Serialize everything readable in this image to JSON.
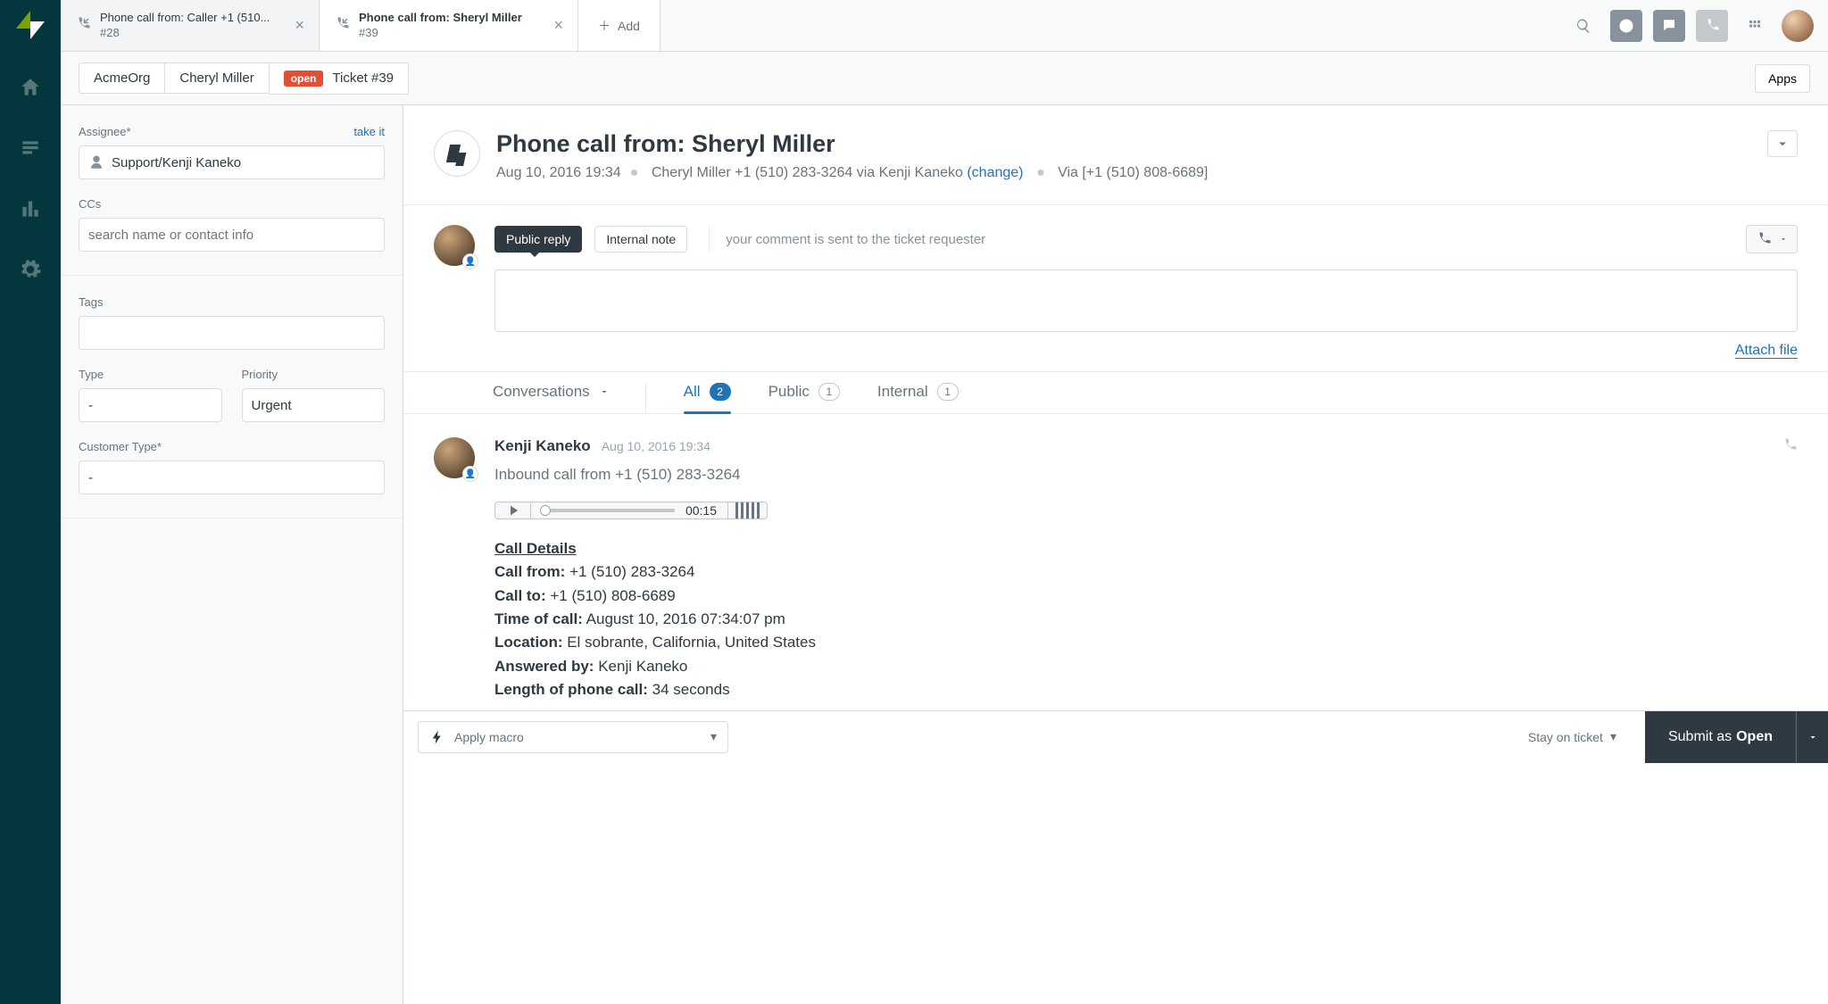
{
  "tabs": [
    {
      "line1": "Phone call from: Caller +1 (510...",
      "line2": "#28",
      "active": false
    },
    {
      "line1": "Phone call from: Sheryl Miller",
      "line2": "#39",
      "active": true
    }
  ],
  "add_tab_label": "Add",
  "breadcrumb": {
    "org": "AcmeOrg",
    "customer": "Cheryl Miller",
    "status": "open",
    "ticket": "Ticket #39"
  },
  "apps_button": "Apps",
  "sidebar": {
    "assignee": {
      "label": "Assignee*",
      "action": "take it",
      "value": "Support/Kenji Kaneko"
    },
    "ccs": {
      "label": "CCs",
      "placeholder": "search name or contact info"
    },
    "tags": {
      "label": "Tags",
      "value": ""
    },
    "type": {
      "label": "Type",
      "value": "-"
    },
    "priority": {
      "label": "Priority",
      "value": "Urgent"
    },
    "customer_type": {
      "label": "Customer Type*",
      "value": "-"
    }
  },
  "ticket": {
    "title": "Phone call from: Sheryl Miller",
    "date": "Aug 10, 2016 19:34",
    "caller": "Cheryl Miller +1 (510) 283-3264 via Kenji Kaneko",
    "change": "(change)",
    "via": "Via [+1 (510) 808-6689]"
  },
  "compose": {
    "public": "Public reply",
    "internal": "Internal note",
    "hint": "your comment is sent to the ticket requester",
    "attach": "Attach file"
  },
  "filters": {
    "conversations": "Conversations",
    "all": {
      "label": "All",
      "count": "2"
    },
    "public": {
      "label": "Public",
      "count": "1"
    },
    "internal": {
      "label": "Internal",
      "count": "1"
    }
  },
  "entry": {
    "who": "Kenji Kaneko",
    "when": "Aug 10, 2016 19:34",
    "line": "Inbound call from +1 (510) 283-3264",
    "player_time": "00:15",
    "details_title": "Call Details",
    "d1_label": "Call from:",
    "d1_value": " +1 (510) 283-3264",
    "d2_label": "Call to:",
    "d2_value": " +1 (510) 808-6689",
    "d3_label": "Time of call:",
    "d3_value": " August 10, 2016 07:34:07 pm",
    "d4_label": "Location:",
    "d4_value": " El sobrante, California, United States",
    "d5_label": "Answered by:",
    "d5_value": " Kenji Kaneko",
    "d6_label": "Length of phone call:",
    "d6_value": " 34 seconds"
  },
  "footer": {
    "macro": "Apply macro",
    "stay": "Stay on ticket",
    "submit_pre": "Submit as",
    "submit_status": "Open"
  }
}
